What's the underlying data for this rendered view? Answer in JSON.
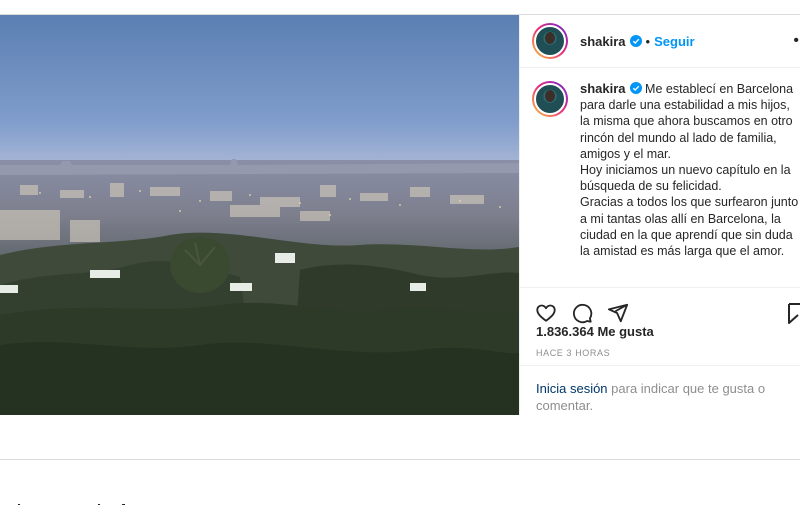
{
  "post": {
    "username": "shakira",
    "follow_label": "Seguir",
    "separator": "•",
    "more_icon": "more-dots-icon",
    "caption": "Me establecí en Barcelona para darle una estabilidad a mis hijos, la misma que ahora buscamos en otro rincón del mundo al lado de familia, amigos y el mar.\nHoy iniciamos un nuevo capítulo en la búsqueda de su felicidad.\nGracias a todos los que surfearon junto a mi tantas olas allí en Barcelona, la ciudad en la que aprendí que sin duda la amistad es más larga que el amor.",
    "likes": "1.836.364 Me gusta",
    "time": "HACE 3 HORAS",
    "login_link": "Inicia sesión",
    "login_rest": " para indicar que te gusta o comentar.",
    "icons": [
      "heart-icon",
      "comment-icon",
      "share-icon",
      "bookmark-icon",
      "verified-badge-icon"
    ]
  },
  "colors": {
    "accent": "#0095f6",
    "link": "#00376b",
    "muted": "#8e8e8e",
    "verified": "#0095f6"
  }
}
